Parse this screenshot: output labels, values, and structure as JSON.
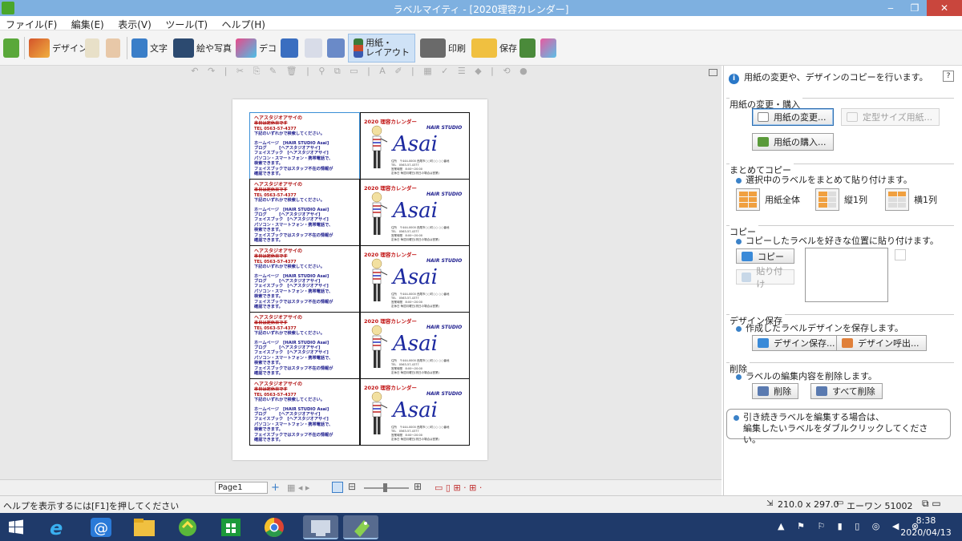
{
  "window": {
    "title": "ラベルマイティ - [2020理容カレンダー]",
    "minimize": "‒",
    "restore": "❐",
    "close": "✕"
  },
  "menu": [
    "ファイル(F)",
    "編集(E)",
    "表示(V)",
    "ツール(T)",
    "ヘルプ(H)"
  ],
  "toolbar": {
    "design": "デザイン",
    "text": "文字",
    "picture": "絵や写真",
    "deco": "デコ",
    "paper_layout": "用紙・\nレイアウト",
    "print": "印刷",
    "save": "保存"
  },
  "label": {
    "left_title": "ヘアスタジオアサイの",
    "left_l2": "本日は定休日です",
    "left_l3": "TEL 0563-57-4377",
    "left_l4": "下記のいずれかで検索してください。",
    "left_l5": "ホームページ　[HAIR STUDIO Asai]",
    "left_l6": "ブログ　　　[ヘアスタジオアサイ]",
    "left_l7": "フェイスブック　[ヘアスタジオアサイ]",
    "left_l8": "パソコン・スマートフォン・携帯電話で、",
    "left_l9": "検索できます。",
    "left_l10": "フェイスブックではスタッフ不在の情報が",
    "left_l11": "確認できます。",
    "year": "2020 理容カレンダー",
    "hair_studio": "HAIR STUDIO",
    "brand": "Asai",
    "addr1": "住所　〒444-0000 西尾市○○町○○ ○○番地",
    "addr2": "TEL　0563-57-4377",
    "addr3": "営業時間　8:00〜20:00",
    "addr4": "定休日 毎週月曜日(祝日の場合は営業)"
  },
  "editor": {
    "page": "Page1"
  },
  "panel": {
    "info": "用紙の変更や、デザインのコピーを行います。",
    "help": "?",
    "sec_paper": "用紙の変更・購入",
    "btn_change_paper": "用紙の変更...",
    "btn_fixed_paper": "定型サイズ用紙...",
    "btn_buy_paper": "用紙の購入...",
    "sec_bulk": "まとめてコピー",
    "bulk_desc": "選択中のラベルをまとめて貼り付けます。",
    "lay_all": "用紙全体",
    "lay_col": "縦1列",
    "lay_row": "横1列",
    "sec_copy": "コピー",
    "copy_desc": "コピーしたラベルを好きな位置に貼り付けます。",
    "btn_copy": "コピー",
    "btn_paste": "貼り付け",
    "sec_design": "デザイン保存",
    "design_desc": "作成したラベルデザインを保存します。",
    "btn_design_save": "デザイン保存...",
    "btn_design_load": "デザイン呼出...",
    "sec_delete": "削除",
    "delete_desc": "ラベルの編集内容を削除します。",
    "btn_delete": "削除",
    "btn_delete_all": "すべて削除",
    "note_l1": "引き続きラベルを編集する場合は、",
    "note_l2": "編集したいラベルをダブルクリックしてください。"
  },
  "status": {
    "help_hint": "ヘルプを表示するには[F1]を押してください",
    "size": "210.0 x 297.0",
    "paper": "エーワン 51002"
  },
  "taskbar": {
    "time": "8:38",
    "date": "2020/04/13"
  }
}
